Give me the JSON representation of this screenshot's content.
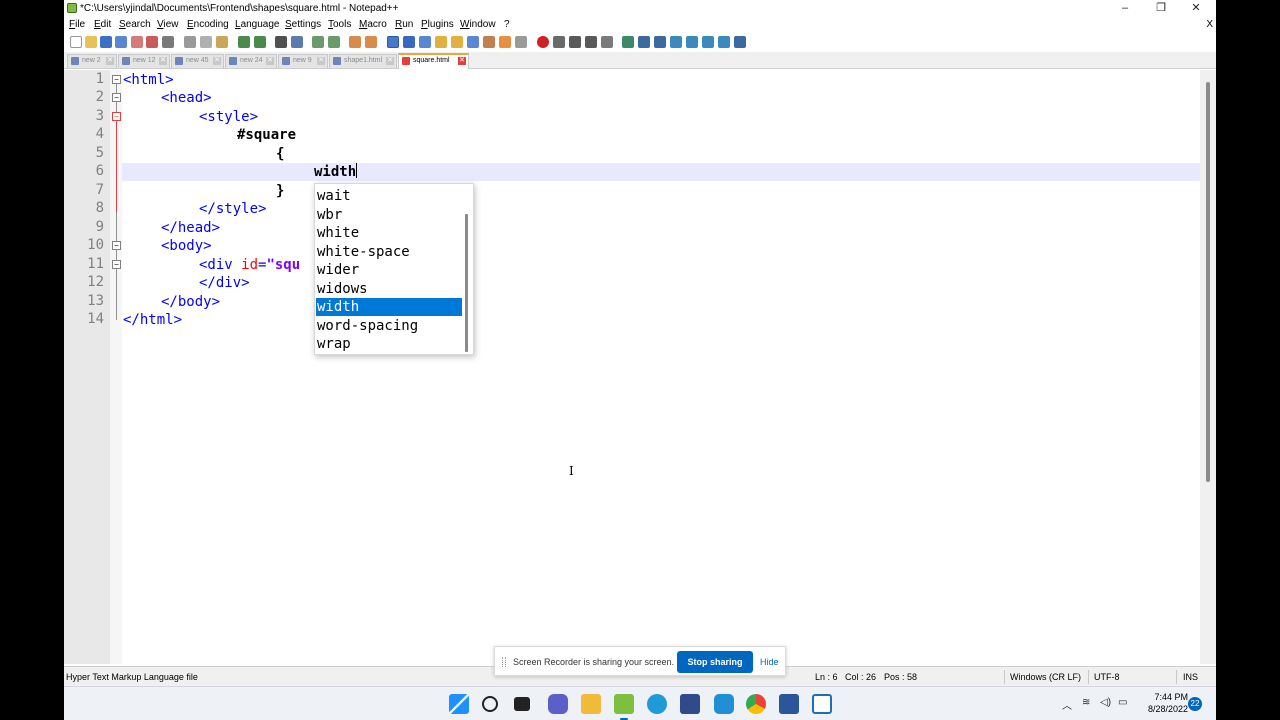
{
  "window": {
    "title": "*C:\\Users\\yjindal\\Documents\\Frontend\\shapes\\square.html - Notepad++",
    "minimize_glyph": "–",
    "restore_glyph": "❐",
    "close_glyph": "✕"
  },
  "menu": [
    "File",
    "Edit",
    "Search",
    "View",
    "Encoding",
    "Language",
    "Settings",
    "Tools",
    "Macro",
    "Run",
    "Plugins",
    "Window",
    "?"
  ],
  "menu_close_doc": "X",
  "tabs": [
    {
      "label": "new 2",
      "active": false
    },
    {
      "label": "new 12",
      "active": false
    },
    {
      "label": "new 45",
      "active": false
    },
    {
      "label": "new 24",
      "active": false
    },
    {
      "label": "new 9",
      "active": false
    },
    {
      "label": "shape1.html",
      "active": false
    },
    {
      "label": "square.html",
      "active": true
    }
  ],
  "tab_close_glyph": "✕",
  "editor": {
    "line_numbers": [
      "1",
      "2",
      "3",
      "4",
      "5",
      "6",
      "7",
      "8",
      "9",
      "10",
      "11",
      "12",
      "13",
      "14"
    ],
    "current_line": 6,
    "lines": {
      "l1_tag": "<html>",
      "l2_tag": "<head>",
      "l3_tag": "<style>",
      "l4_selector": "#square",
      "l5_brace": "{",
      "l6_text": "width",
      "l7_brace": "}",
      "l8_tag": "</style>",
      "l9_tag": "</head>",
      "l10_tag": "<body>",
      "l11_tag_open": "<div ",
      "l11_attr": "id",
      "l11_eq": "=",
      "l11_str": "\"squ",
      "l12_tag": "</div>",
      "l13_tag": "</body>",
      "l14_tag": "</html>"
    }
  },
  "autocomplete": {
    "items": [
      "wait",
      "wbr",
      "white",
      "white-space",
      "wider",
      "widows",
      "width",
      "word-spacing",
      "wrap"
    ],
    "selected_index": 6
  },
  "cursor_glyph": "I",
  "share_banner": {
    "message": "Screen Recorder is sharing your screen.",
    "stop_label": "Stop sharing",
    "hide_label": "Hide"
  },
  "status": {
    "file_type": "Hyper Text Markup Language file",
    "ln": "Ln : 6",
    "col": "Col : 26",
    "pos": "Pos : 58",
    "eol": "Windows (CR LF)",
    "encoding": "UTF-8",
    "mode": "INS"
  },
  "taskbar": {
    "time": "7:44 PM",
    "date": "8/28/2022",
    "notification_count": "22",
    "tray_chevron": "︿"
  },
  "colors": {
    "tag": "#0000ff",
    "attribute": "#ff0000",
    "string": "#8000ff",
    "selection": "#0078d7",
    "current_line": "#e8e8ff",
    "active_tab_accent": "#f2a33a"
  }
}
